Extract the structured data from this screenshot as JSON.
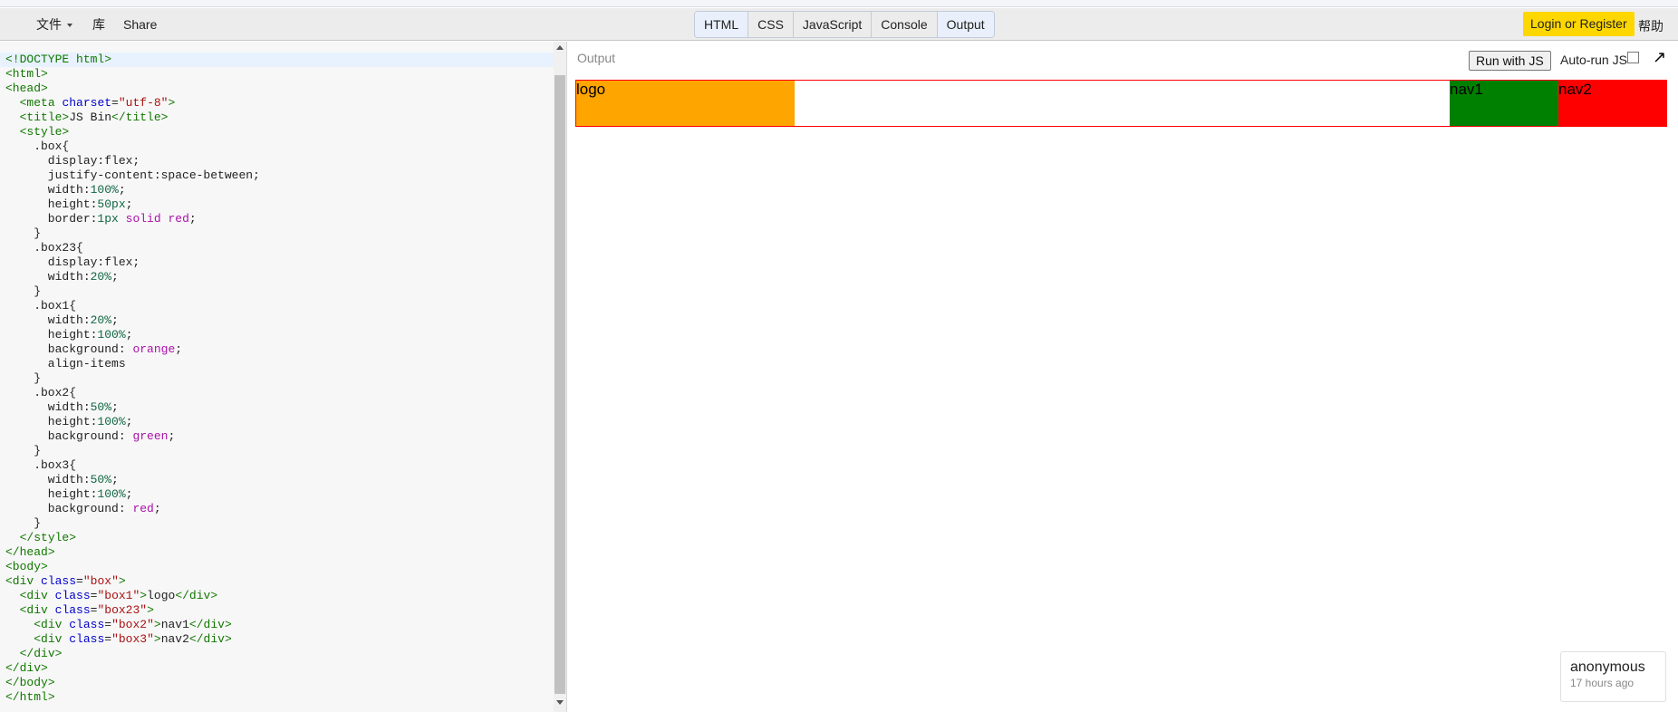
{
  "menu": {
    "file_label": "文件",
    "library_label": "库",
    "share_label": "Share"
  },
  "tabs": [
    {
      "label": "HTML",
      "active": true
    },
    {
      "label": "CSS",
      "active": false
    },
    {
      "label": "JavaScript",
      "active": false
    },
    {
      "label": "Console",
      "active": false
    },
    {
      "label": "Output",
      "active": true
    }
  ],
  "account": {
    "login_label": "Login or Register",
    "help_label": "帮助"
  },
  "editor": {
    "lines": [
      "<!DOCTYPE html>",
      "<html>",
      "<head>",
      "  <meta charset=\"utf-8\">",
      "  <title>JS Bin</title>",
      "  <style>",
      "    .box{",
      "      display:flex;",
      "      justify-content:space-between;",
      "      width:100%;",
      "      height:50px;",
      "      border:1px solid red;",
      "    }",
      "    .box23{",
      "      display:flex;",
      "      width:20%;",
      "    }",
      "    .box1{",
      "      width:20%;",
      "      height:100%;",
      "      background: orange;",
      "      align-items",
      "    }",
      "    .box2{",
      "      width:50%;",
      "      height:100%;",
      "      background: green;",
      "    }",
      "    .box3{",
      "      width:50%;",
      "      height:100%;",
      "      background: red;",
      "    }",
      "  </style>",
      "</head>",
      "<body>",
      "<div class=\"box\">",
      "  <div class=\"box1\">logo</div>",
      "  <div class=\"box23\">",
      "    <div class=\"box2\">nav1</div>",
      "    <div class=\"box3\">nav2</div>",
      "  </div>",
      "</div>",
      "</body>",
      "</html>"
    ],
    "current_line": 0
  },
  "output": {
    "label": "Output",
    "run_label": "Run with JS",
    "autorun_label": "Auto-run JS",
    "autorun_checked": false,
    "popout_icon": "popout-arrow-icon",
    "demo": {
      "box1_text": "logo",
      "box2_text": "nav1",
      "box3_text": "nav2",
      "colors": {
        "border": "#ff0000",
        "box1": "#ffa500",
        "box2": "#008000",
        "box3": "#ff0000"
      }
    }
  },
  "user": {
    "name": "anonymous",
    "time": "17 hours ago"
  }
}
